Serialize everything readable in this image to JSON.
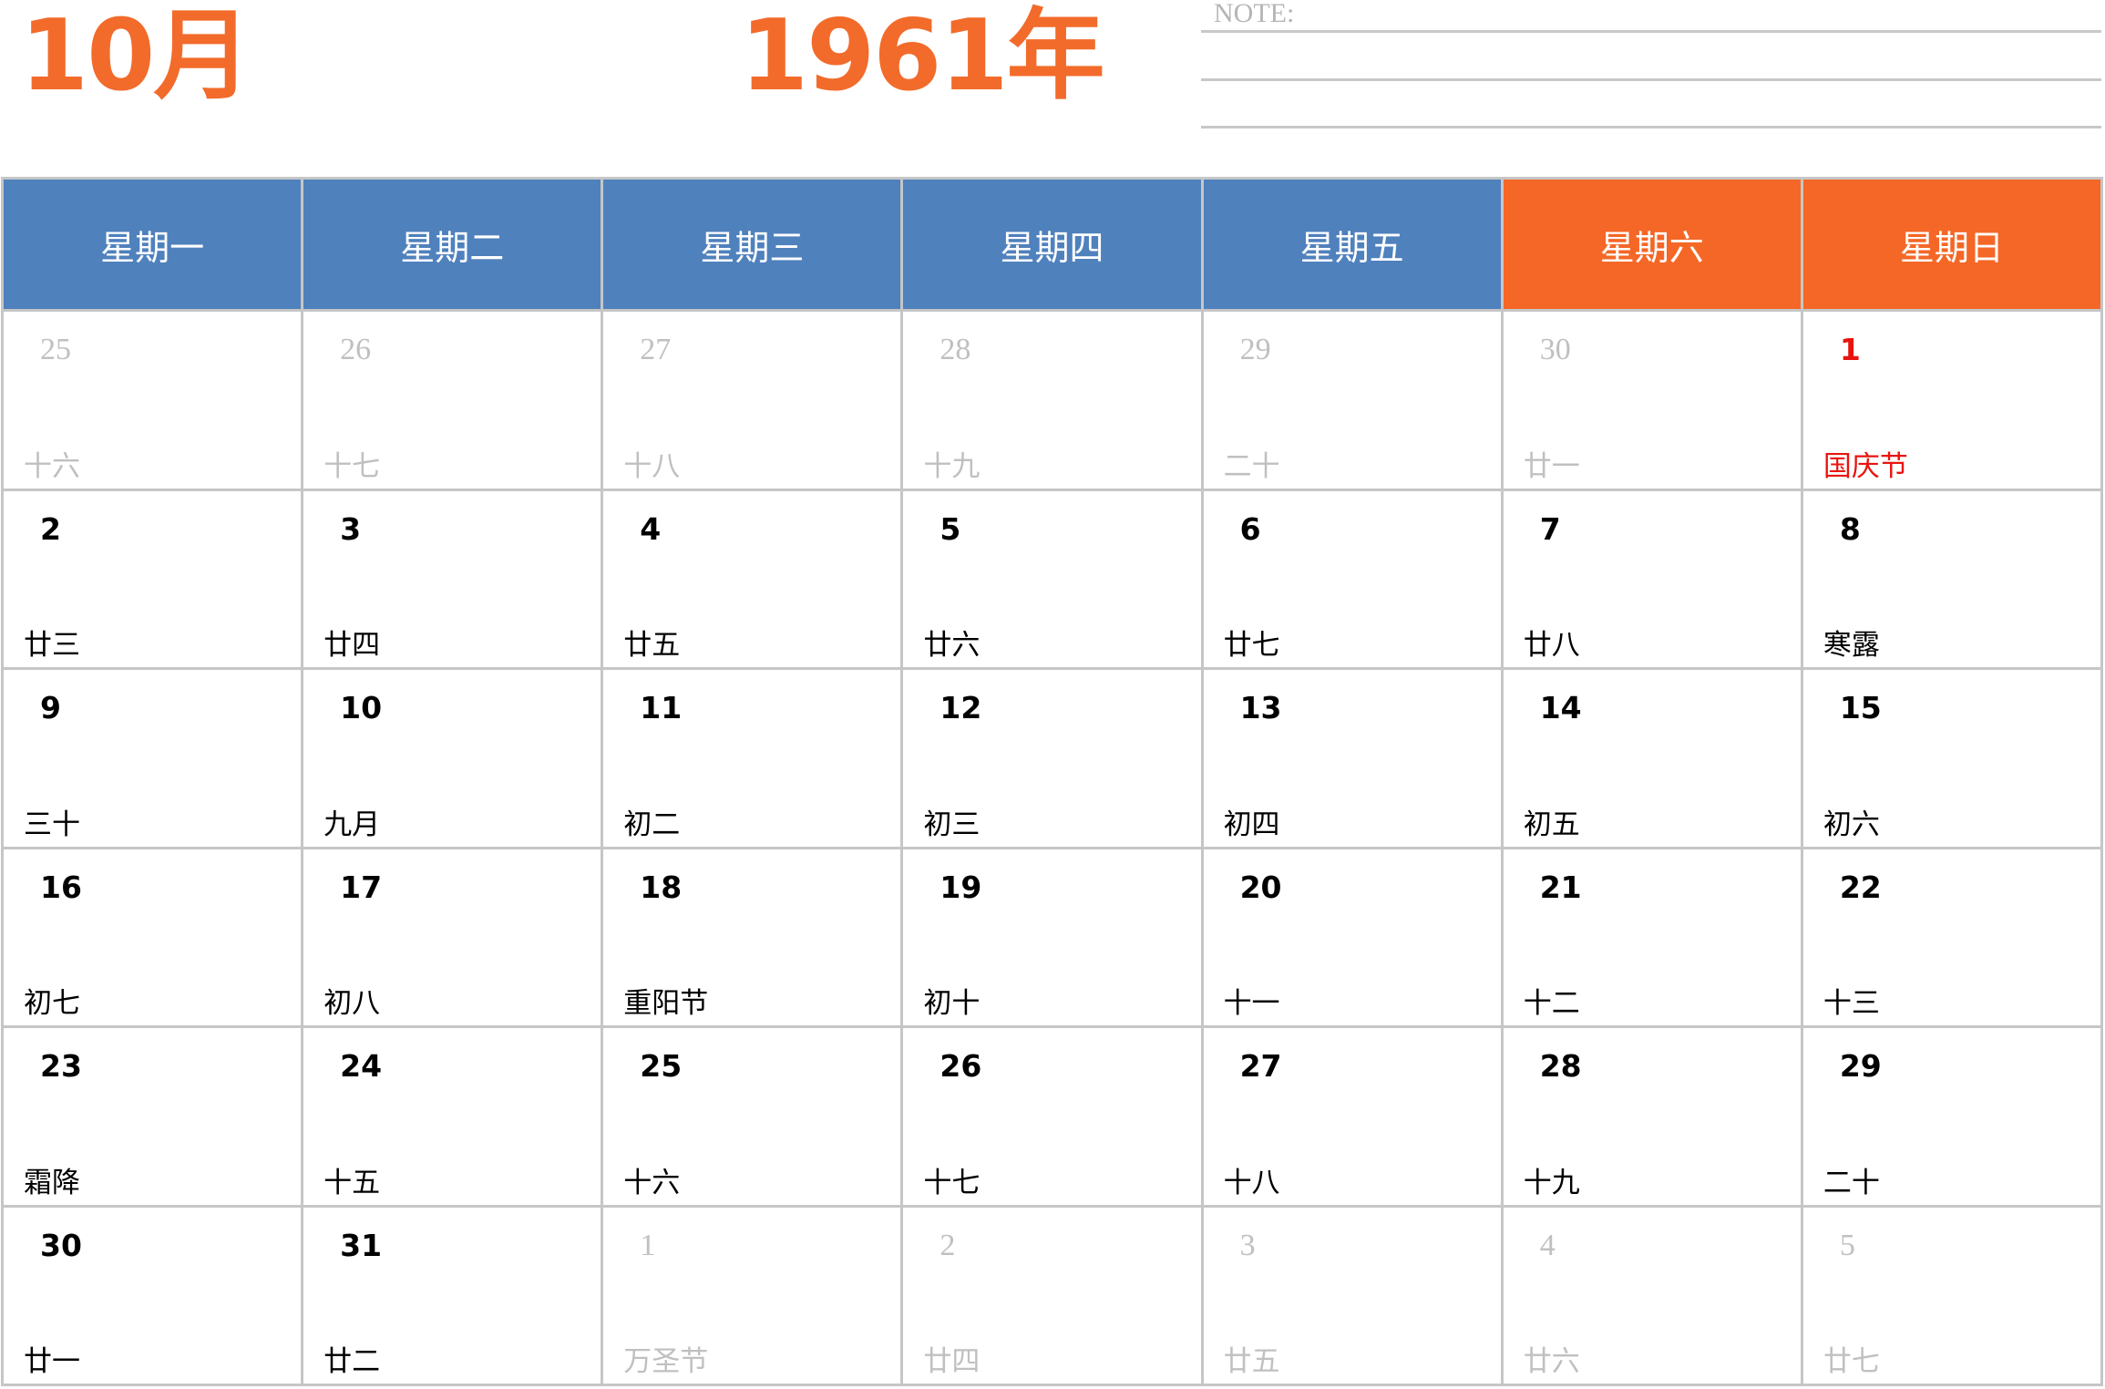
{
  "header": {
    "month": "10月",
    "year": "1961年",
    "note_label": "NOTE:"
  },
  "weekdays": [
    {
      "label": "星期一",
      "weekend": false
    },
    {
      "label": "星期二",
      "weekend": false
    },
    {
      "label": "星期三",
      "weekend": false
    },
    {
      "label": "星期四",
      "weekend": false
    },
    {
      "label": "星期五",
      "weekend": false
    },
    {
      "label": "星期六",
      "weekend": true
    },
    {
      "label": "星期日",
      "weekend": true
    }
  ],
  "colors": {
    "title": "#f26b2b",
    "weekday_header": "#4f81bd",
    "weekend_header": "#f56726",
    "holiday": "#e8140f",
    "other_month": "#c0c0c0"
  },
  "weeks": [
    [
      {
        "day": "25",
        "lunar": "十六",
        "other": true
      },
      {
        "day": "26",
        "lunar": "十七",
        "other": true
      },
      {
        "day": "27",
        "lunar": "十八",
        "other": true
      },
      {
        "day": "28",
        "lunar": "十九",
        "other": true
      },
      {
        "day": "29",
        "lunar": "二十",
        "other": true
      },
      {
        "day": "30",
        "lunar": "廿一",
        "other": true
      },
      {
        "day": "1",
        "lunar": "国庆节",
        "holiday": true
      }
    ],
    [
      {
        "day": "2",
        "lunar": "廿三"
      },
      {
        "day": "3",
        "lunar": "廿四"
      },
      {
        "day": "4",
        "lunar": "廿五"
      },
      {
        "day": "5",
        "lunar": "廿六"
      },
      {
        "day": "6",
        "lunar": "廿七"
      },
      {
        "day": "7",
        "lunar": "廿八"
      },
      {
        "day": "8",
        "lunar": "寒露"
      }
    ],
    [
      {
        "day": "9",
        "lunar": "三十"
      },
      {
        "day": "10",
        "lunar": "九月"
      },
      {
        "day": "11",
        "lunar": "初二"
      },
      {
        "day": "12",
        "lunar": "初三"
      },
      {
        "day": "13",
        "lunar": "初四"
      },
      {
        "day": "14",
        "lunar": "初五"
      },
      {
        "day": "15",
        "lunar": "初六"
      }
    ],
    [
      {
        "day": "16",
        "lunar": "初七"
      },
      {
        "day": "17",
        "lunar": "初八"
      },
      {
        "day": "18",
        "lunar": "重阳节"
      },
      {
        "day": "19",
        "lunar": "初十"
      },
      {
        "day": "20",
        "lunar": "十一"
      },
      {
        "day": "21",
        "lunar": "十二"
      },
      {
        "day": "22",
        "lunar": "十三"
      }
    ],
    [
      {
        "day": "23",
        "lunar": "霜降"
      },
      {
        "day": "24",
        "lunar": "十五"
      },
      {
        "day": "25",
        "lunar": "十六"
      },
      {
        "day": "26",
        "lunar": "十七"
      },
      {
        "day": "27",
        "lunar": "十八"
      },
      {
        "day": "28",
        "lunar": "十九"
      },
      {
        "day": "29",
        "lunar": "二十"
      }
    ],
    [
      {
        "day": "30",
        "lunar": "廿一"
      },
      {
        "day": "31",
        "lunar": "廿二"
      },
      {
        "day": "1",
        "lunar": "万圣节",
        "other": true
      },
      {
        "day": "2",
        "lunar": "廿四",
        "other": true
      },
      {
        "day": "3",
        "lunar": "廿五",
        "other": true
      },
      {
        "day": "4",
        "lunar": "廿六",
        "other": true
      },
      {
        "day": "5",
        "lunar": "廿七",
        "other": true
      }
    ]
  ]
}
